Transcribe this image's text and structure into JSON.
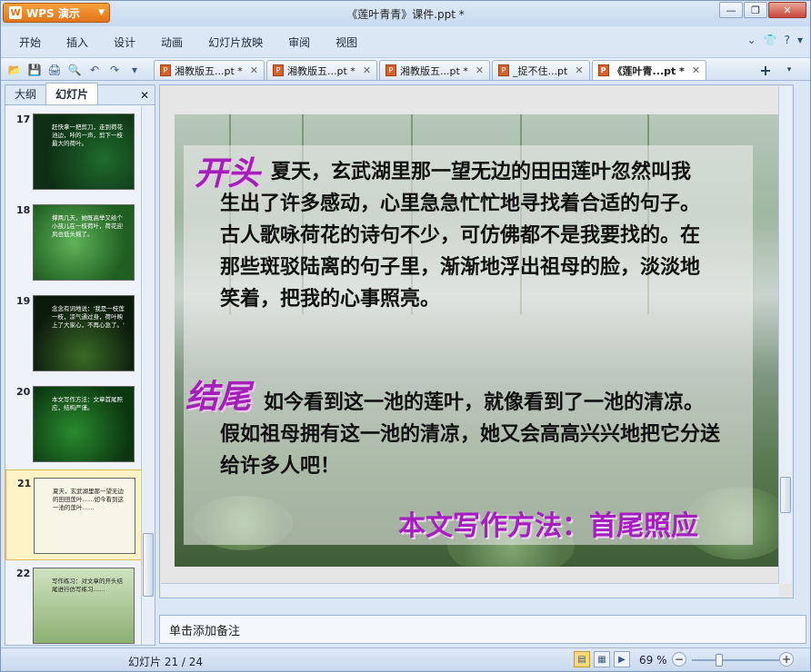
{
  "app": {
    "name": "WPS 演示",
    "logo": "W"
  },
  "window": {
    "title": "《莲叶青青》课件.ppt *"
  },
  "menu": [
    "开始",
    "插入",
    "设计",
    "动画",
    "幻灯片放映",
    "审阅",
    "视图"
  ],
  "doc_tabs": [
    {
      "label": "湘教版五...pt *"
    },
    {
      "label": "湘教版五...pt *"
    },
    {
      "label": "湘教版五...pt *"
    },
    {
      "label": "_捉不住...pt"
    },
    {
      "label": "《莲叶青...pt *"
    }
  ],
  "panel": {
    "tab_outline": "大纲",
    "tab_slides": "幻灯片"
  },
  "thumbnails": [
    {
      "num": "17",
      "text": "赶快拿一把剪刀，走到荷花池边，咔的一声，剪下一枝最大的荷叶。"
    },
    {
      "num": "18",
      "text": "撑两几天，她既高举又给个小孩儿在一枝荷叶，荷花迎风也低头摇了。"
    },
    {
      "num": "19",
      "text": "念念有词地说：'我是一枝莲一枝，凉气通过身，荷叶映上了大家心，不再心急了。'"
    },
    {
      "num": "20",
      "text": "本文写作方法：文章首尾照应，结构严谨。"
    },
    {
      "num": "21",
      "text": "夏天，玄武湖里那一望无边的田田莲叶……如今看到这一池的莲叶……"
    },
    {
      "num": "22",
      "text": "写作练习：对文章的开头结尾进行仿写练习……"
    }
  ],
  "slide": {
    "label_start": "开头",
    "para_start": "夏天，玄武湖里那一望无边的田田莲叶忽然叫我生出了许多感动，心里急急忙忙地寻找着合适的句子。古人歌咏荷花的诗句不少，可仿佛都不是我要找的。在那些斑驳陆离的句子里，渐渐地浮出祖母的脸，淡淡地笑着，把我的心事照亮。",
    "label_end": "结尾",
    "para_end": "如今看到这一池的莲叶，就像看到了一池的清凉。假如祖母拥有这一池的清凉，她又会高高兴兴地把它分送给许多人吧！",
    "conclusion": "本文写作方法：首尾照应"
  },
  "notes": {
    "placeholder": "单击添加备注"
  },
  "status": {
    "slide_counter": "幻灯片 21 / 24",
    "zoom": "69 %"
  }
}
